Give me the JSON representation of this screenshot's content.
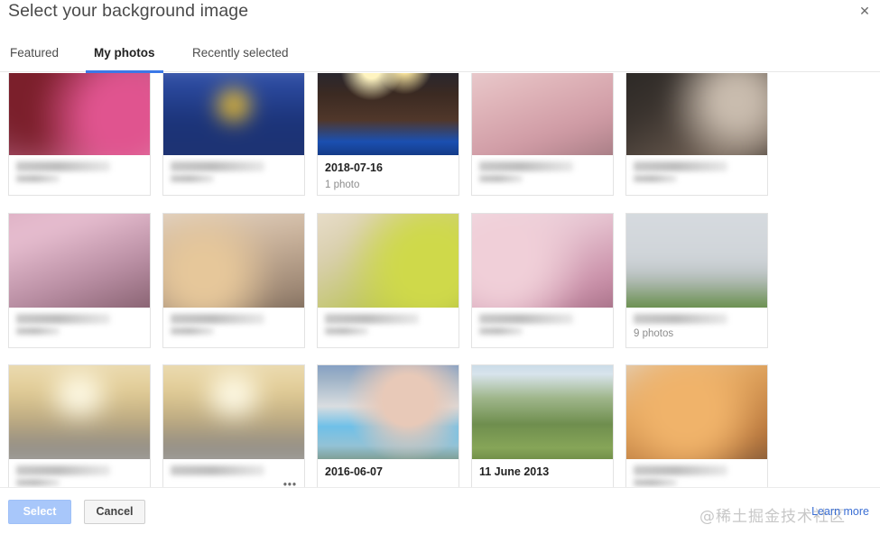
{
  "dialog": {
    "title": "Select your background image",
    "close_icon": "close-icon",
    "close_glyph": "✕"
  },
  "tabs": [
    {
      "id": "featured",
      "label": "Featured",
      "active": false
    },
    {
      "id": "my-photos",
      "label": "My photos",
      "active": true
    },
    {
      "id": "recently-selected",
      "label": "Recently selected",
      "active": false
    }
  ],
  "grid": {
    "columns": 5,
    "rows": [
      {
        "cells": [
          {
            "title": "",
            "subtitle": "",
            "redacted": true,
            "thumb": "photo-people-pink",
            "clipped_top": true
          },
          {
            "title": "",
            "subtitle": "",
            "redacted": true,
            "thumb": "photo-superhero-blue",
            "clipped_top": true
          },
          {
            "title": "2018-07-16",
            "subtitle": "1 photo",
            "redacted": false,
            "thumb": "photo-concert-crowd",
            "clipped_top": true
          },
          {
            "title": "",
            "subtitle": "",
            "redacted": true,
            "thumb": "photo-indoor-warm",
            "clipped_top": true
          },
          {
            "title": "",
            "subtitle": "",
            "redacted": true,
            "thumb": "photo-dark-scene",
            "clipped_top": true
          }
        ]
      },
      {
        "cells": [
          {
            "title": "",
            "subtitle": "",
            "redacted": true,
            "thumb": "photo-group-pink",
            "clipped_top": false
          },
          {
            "title": "",
            "subtitle": "",
            "redacted": true,
            "thumb": "photo-table-food",
            "clipped_top": false
          },
          {
            "title": "",
            "subtitle": "",
            "redacted": true,
            "thumb": "photo-green-yellow",
            "clipped_top": false
          },
          {
            "title": "",
            "subtitle": "",
            "redacted": true,
            "thumb": "photo-portrait-pink",
            "clipped_top": false
          },
          {
            "title": "",
            "subtitle": "9 photos",
            "redacted": true,
            "thumb": "photo-museum-colonnade",
            "clipped_top": false
          }
        ]
      },
      {
        "cells": [
          {
            "title": "",
            "subtitle": "",
            "redacted": true,
            "thumb": "photo-subway-corridor",
            "clipped_top": false
          },
          {
            "title": "",
            "subtitle": "•••",
            "redacted": true,
            "thumb": "photo-subway-corridor",
            "clipped_top": false
          },
          {
            "title": "2016-06-07",
            "subtitle": "",
            "redacted": false,
            "thumb": "photo-collage-blur",
            "clipped_top": false
          },
          {
            "title": "11 June 2013",
            "subtitle": "",
            "redacted": false,
            "thumb": "photo-countryside-view",
            "clipped_top": false
          },
          {
            "title": "",
            "subtitle": "",
            "redacted": true,
            "thumb": "photo-orange-indoor",
            "clipped_top": false
          }
        ]
      }
    ]
  },
  "footer": {
    "select_label": "Select",
    "cancel_label": "Cancel",
    "learn_more_label": "Learn more",
    "watermark": "@稀土掘金技术社区"
  },
  "colors": {
    "accent": "#3b78e7",
    "select_button": "#a8c7fa",
    "link": "#3b6fd4",
    "title_text": "#4a4a4a",
    "subtitle_text": "#8d8d8d",
    "border": "#e3e3e3"
  }
}
